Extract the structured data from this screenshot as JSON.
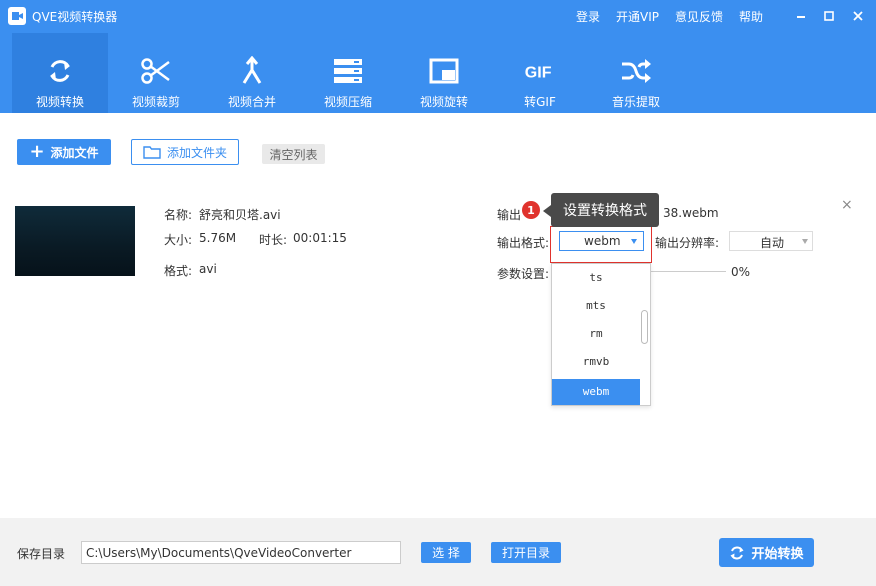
{
  "app": {
    "title": "QVE视频转换器",
    "links": [
      "登录",
      "开通VIP",
      "意见反馈",
      "帮助"
    ]
  },
  "toolbar": {
    "items": [
      {
        "label": "视频转换",
        "icon": "refresh-icon",
        "active": true
      },
      {
        "label": "视频裁剪",
        "icon": "scissors-icon",
        "active": false
      },
      {
        "label": "视频合并",
        "icon": "merge-icon",
        "active": false
      },
      {
        "label": "视频压缩",
        "icon": "compress-icon",
        "active": false
      },
      {
        "label": "视频旋转",
        "icon": "rotate-icon",
        "active": false
      },
      {
        "label": "转GIF",
        "icon": "gif-icon",
        "active": false
      },
      {
        "label": "音乐提取",
        "icon": "shuffle-icon",
        "active": false
      }
    ]
  },
  "actions": {
    "add_file": "添加文件",
    "add_folder": "添加文件夹",
    "clear_list": "清空列表"
  },
  "file": {
    "name_label": "名称:",
    "name": "舒亮和贝塔.avi",
    "size_label": "大小:",
    "size": "5.76M",
    "duration_label": "时长:",
    "duration": "00:01:15",
    "format_label": "格式:",
    "format": "avi",
    "output_name_label": "输出",
    "output_name_tail": "38.webm",
    "output_format_label": "输出格式:",
    "output_format": "webm",
    "resolution_label": "输出分辨率:",
    "resolution": "自动",
    "params_label": "参数设置:",
    "progress": "0%"
  },
  "dropdown": {
    "options": [
      "ts",
      "mts",
      "rm",
      "rmvb",
      "webm"
    ],
    "selected": "webm"
  },
  "tooltip": {
    "step": "1",
    "text": "设置转换格式"
  },
  "footer": {
    "save_label": "保存目录",
    "save_path": "C:\\Users\\My\\Documents\\QveVideoConverter",
    "choose": "选 择",
    "open_dir": "打开目录",
    "start": "开始转换"
  },
  "colors": {
    "accent": "#3b8ff0",
    "highlight": "#e0332d"
  }
}
